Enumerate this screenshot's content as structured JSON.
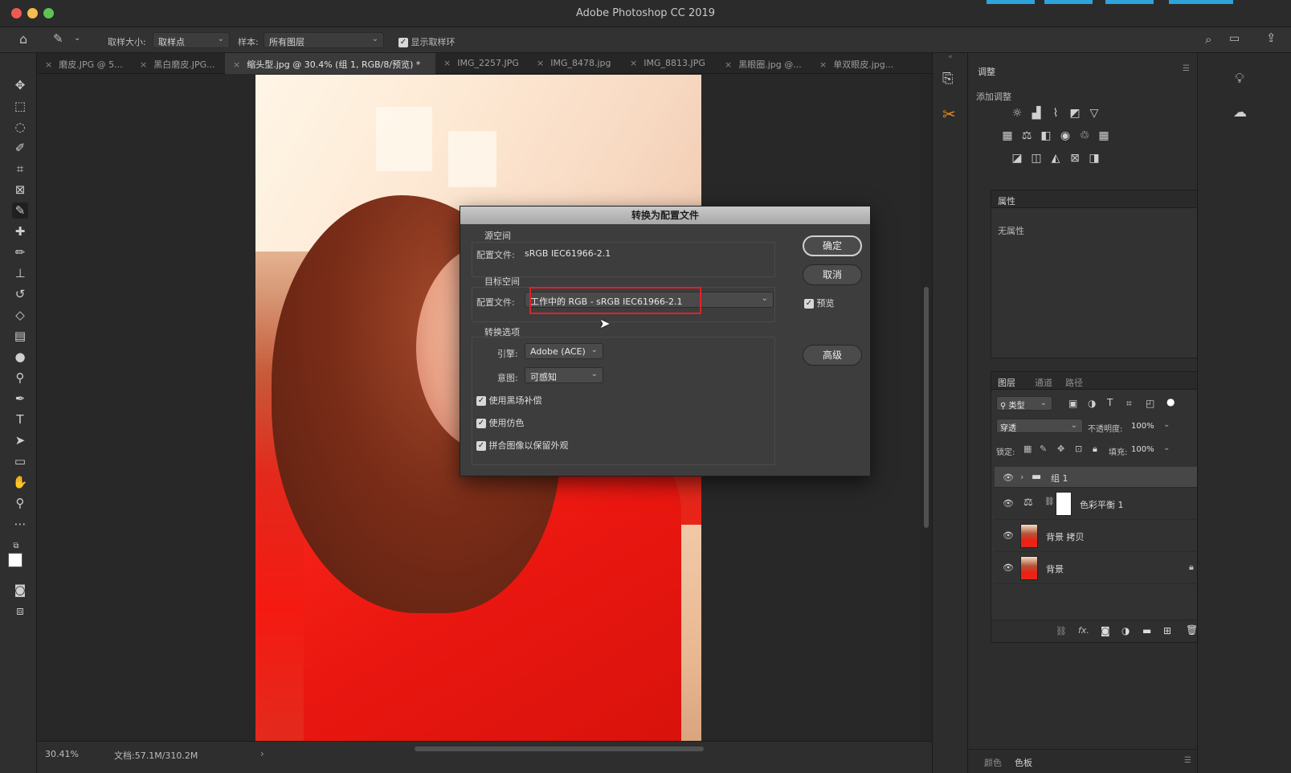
{
  "app": {
    "title": "Adobe Photoshop CC 2019"
  },
  "options_bar": {
    "sample_size_label": "取样大小:",
    "sample_size_value": "取样点",
    "sample_label": "样本:",
    "sample_value": "所有图层",
    "show_ring_label": "显示取样环"
  },
  "tabs": [
    {
      "label": "磨皮.JPG @ 5..."
    },
    {
      "label": "黑白磨皮.JPG..."
    },
    {
      "label": "缩头型.jpg @ 30.4% (组 1, RGB/8/预览) *"
    },
    {
      "label": "IMG_2257.JPG"
    },
    {
      "label": "IMG_8478.jpg"
    },
    {
      "label": "IMG_8813.JPG"
    },
    {
      "label": "黑眼圈.jpg @..."
    },
    {
      "label": "单双眼皮.jpg..."
    }
  ],
  "status_bar": {
    "zoom": "30.41%",
    "doc_info": "文档:57.1M/310.2M",
    "arrow": "›"
  },
  "dialog": {
    "title": "转换为配置文件",
    "source_space_label": "源空间",
    "source_profile_label": "配置文件:",
    "source_profile_value": "sRGB IEC61966-2.1",
    "dest_space_label": "目标空间",
    "dest_profile_label": "配置文件:",
    "dest_profile_value": "工作中的 RGB - sRGB IEC61966-2.1",
    "options_label": "转换选项",
    "engine_label": "引擎:",
    "engine_value": "Adobe (ACE)",
    "intent_label": "意图:",
    "intent_value": "可感知",
    "check_bpc": "使用黑场补偿",
    "check_dither": "使用仿色",
    "check_flatten": "拼合图像以保留外观",
    "ok_button": "确定",
    "cancel_button": "取消",
    "preview_label": "预览",
    "advanced_button": "高级"
  },
  "adjustments_panel": {
    "title": "调整",
    "add_label": "添加调整"
  },
  "properties_panel": {
    "title": "属性",
    "empty_text": "无属性"
  },
  "layers_panel": {
    "tabs": [
      "图层",
      "通道",
      "路径"
    ],
    "filter_label": "类型",
    "blend_mode": "穿透",
    "opacity_label": "不透明度:",
    "opacity_value": "100%",
    "lock_label": "锁定:",
    "fill_label": "填充:",
    "fill_value": "100%",
    "layers": [
      {
        "name": "组 1",
        "kind": "group"
      },
      {
        "name": "色彩平衡 1",
        "kind": "adjustment"
      },
      {
        "name": "背景 拷贝",
        "kind": "image"
      },
      {
        "name": "背景",
        "kind": "image-locked"
      }
    ],
    "footer_icons": [
      "link-icon",
      "fx-icon",
      "mask-icon",
      "adjustment-icon",
      "folder-icon",
      "new-layer-icon",
      "trash-icon"
    ],
    "fx_text": "fx."
  },
  "bottom_panel": {
    "tabs": [
      "颜色",
      "色板"
    ]
  },
  "colors": {
    "highlight": "#e2202a",
    "accent_blue": "#2ea3dc",
    "layer_selected": "#474747"
  }
}
